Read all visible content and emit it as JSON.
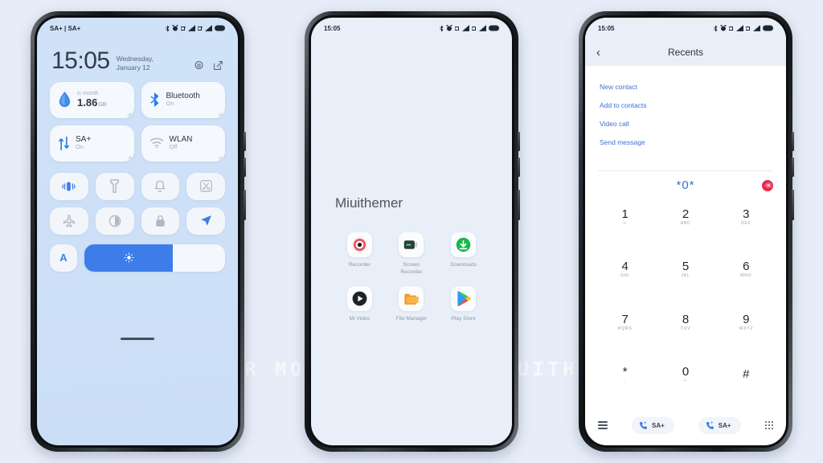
{
  "watermark": "VISIT FOR MORE THEMES - MIUITHEMER.COM",
  "colors": {
    "page_bg": "#e7edf8",
    "accent_blue": "#3e7ce9",
    "link_blue": "#3f6fd8",
    "delete_red": "#e8284f",
    "phone1_screen": "#cde0f7",
    "phone2_screen": "#e9eff8",
    "phone3_header": "#e8eff7"
  },
  "phone1": {
    "status": {
      "carrier": "SA+ | SA+",
      "icons": [
        "bluetooth-icon",
        "alarm-icon",
        "sim1-signal-icon",
        "sim2-signal-icon",
        "battery-icon"
      ]
    },
    "clock": {
      "time": "15:05",
      "date": "Wednesday, January 12"
    },
    "clock_actions": [
      {
        "name": "settings-gear-icon",
        "label": "Settings"
      },
      {
        "name": "edit-icon",
        "label": "Edit"
      }
    ],
    "big_tiles": [
      {
        "icon": "data-usage-drop-icon",
        "sub": "is month",
        "value": "1.86",
        "unit": "GB",
        "type": "data"
      },
      {
        "icon": "bluetooth-icon",
        "title": "Bluetooth",
        "state": "On",
        "type": "toggle"
      },
      {
        "icon": "mobile-data-arrows-icon",
        "title": "SA+",
        "state": "On",
        "type": "toggle"
      },
      {
        "icon": "wifi-icon",
        "title": "WLAN",
        "state": "Off",
        "type": "toggle"
      }
    ],
    "quick_tiles": [
      {
        "name": "vibrate-icon",
        "label": "Vibrate",
        "active": true
      },
      {
        "name": "flashlight-icon",
        "label": "Flashlight",
        "active": false
      },
      {
        "name": "bell-icon",
        "label": "Do not disturb",
        "active": false
      },
      {
        "name": "screenshot-icon",
        "label": "Screenshot",
        "active": false
      },
      {
        "name": "airplane-icon",
        "label": "Airplane mode",
        "active": false
      },
      {
        "name": "dark-mode-icon",
        "label": "Dark mode",
        "active": false
      },
      {
        "name": "lock-icon",
        "label": "Lock",
        "active": false
      },
      {
        "name": "location-icon",
        "label": "Location",
        "active": true
      }
    ],
    "brightness": {
      "auto_label": "A",
      "icon": "sun-icon",
      "fill_percent": 63
    }
  },
  "phone2": {
    "status": {
      "time": "15:05",
      "icons": [
        "bluetooth-icon",
        "alarm-icon",
        "sim1-signal-icon",
        "sim2-signal-icon",
        "battery-icon"
      ]
    },
    "folder_name": "Miuithemer",
    "apps": [
      {
        "label": "Recorder",
        "icon": "recorder-icon"
      },
      {
        "label": "Screen Recorder",
        "icon": "screen-recorder-icon"
      },
      {
        "label": "Downloads",
        "icon": "downloads-icon"
      },
      {
        "label": "Mi Video",
        "icon": "mi-video-icon"
      },
      {
        "label": "File Manager",
        "icon": "file-manager-icon"
      },
      {
        "label": "Play Store",
        "icon": "play-store-icon"
      }
    ]
  },
  "phone3": {
    "status": {
      "time": "15:05",
      "icons": [
        "bluetooth-icon",
        "alarm-icon",
        "sim1-signal-icon",
        "sim2-signal-icon",
        "battery-icon"
      ]
    },
    "appbar": {
      "back": "‹",
      "title": "Recents"
    },
    "actions": [
      {
        "label": "New contact"
      },
      {
        "label": "Add to contacts"
      },
      {
        "label": "Video call"
      },
      {
        "label": "Send message"
      }
    ],
    "dialed_number": "*0*",
    "delete_label": "Delete",
    "keys": [
      {
        "num": "1",
        "sub": "∞"
      },
      {
        "num": "2",
        "sub": "ABC"
      },
      {
        "num": "3",
        "sub": "DEF"
      },
      {
        "num": "4",
        "sub": "GHI"
      },
      {
        "num": "5",
        "sub": "JKL"
      },
      {
        "num": "6",
        "sub": "MNO"
      },
      {
        "num": "7",
        "sub": "PQRS"
      },
      {
        "num": "8",
        "sub": "TUV"
      },
      {
        "num": "9",
        "sub": "WXYZ"
      },
      {
        "num": "*",
        "sub": ","
      },
      {
        "num": "0",
        "sub": "+"
      },
      {
        "num": "#",
        "sub": ""
      }
    ],
    "bottom": {
      "menu_label": "Menu",
      "call_buttons": [
        {
          "label": "SA+",
          "sim": 1
        },
        {
          "label": "SA+",
          "sim": 2
        }
      ],
      "keypad_label": "Keypad"
    }
  }
}
